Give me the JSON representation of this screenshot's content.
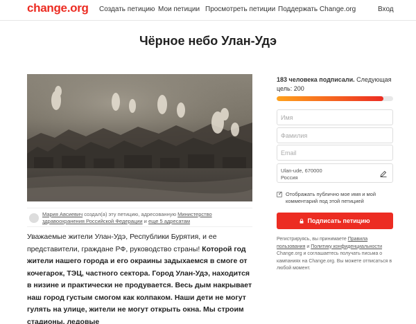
{
  "header": {
    "logo": "change.org",
    "nav": {
      "create": "Создать петицию",
      "my": "Мои петиции",
      "browse": "Просмотреть петиции",
      "support": "Поддержать Change.org",
      "login": "Вход"
    }
  },
  "petition": {
    "title": "Чёрное небо Улан-Удэ",
    "photo_icon": "smog-city-photo",
    "author": {
      "name": "Мария Авсиевич",
      "created": " создал(а) эту петицию, адресованную ",
      "recipient": "Министерство здравоохранения Российской Федерации",
      "and": " и ",
      "more": "еще 5 адресатам"
    },
    "body": {
      "part1": "Уважаемые жители Улан-Удэ, Республики Бурятия, и ее представители,  граждане РФ, руководство страны! ",
      "part2": "Которой год жители нашего города и его окраины задыхаемся в смоге от кочегарок, ТЭЦ, частного сектора. Город Улан-Удэ,  находится в низине и практически не продувается. Весь дым накрывает наш город густым смогом как колпаком. Наши дети не могут гулять на улице, жители не могут открыть окна. Мы строим стадионы, ледовые"
    }
  },
  "sign": {
    "count_bold": "183 человека подписали.",
    "count_rest": " Следующая цель: 200",
    "progress": 0.915,
    "fields": {
      "first_name": "Имя",
      "last_name": "Фамилия",
      "email": "Email"
    },
    "address_line1": "Ulan-ude, 670000",
    "address_line2": "Россия",
    "checkbox_label": "Отображать публично мое имя и мой комментарий под этой петицией",
    "checkbox_checked": true,
    "button_label": "Подписать петицию",
    "legal": {
      "p1": "Регистрируясь, вы принимаете ",
      "terms": "Правила пользования",
      "p2": " и ",
      "privacy": "Политику конфиденциальности",
      "p3": " Change.org и соглашаетесь получать письма о кампаниях на Change.org. Вы можете отписаться в любой момент."
    }
  },
  "colors": {
    "brand": "#ec2c22",
    "progress_start": "#ffa21d"
  }
}
